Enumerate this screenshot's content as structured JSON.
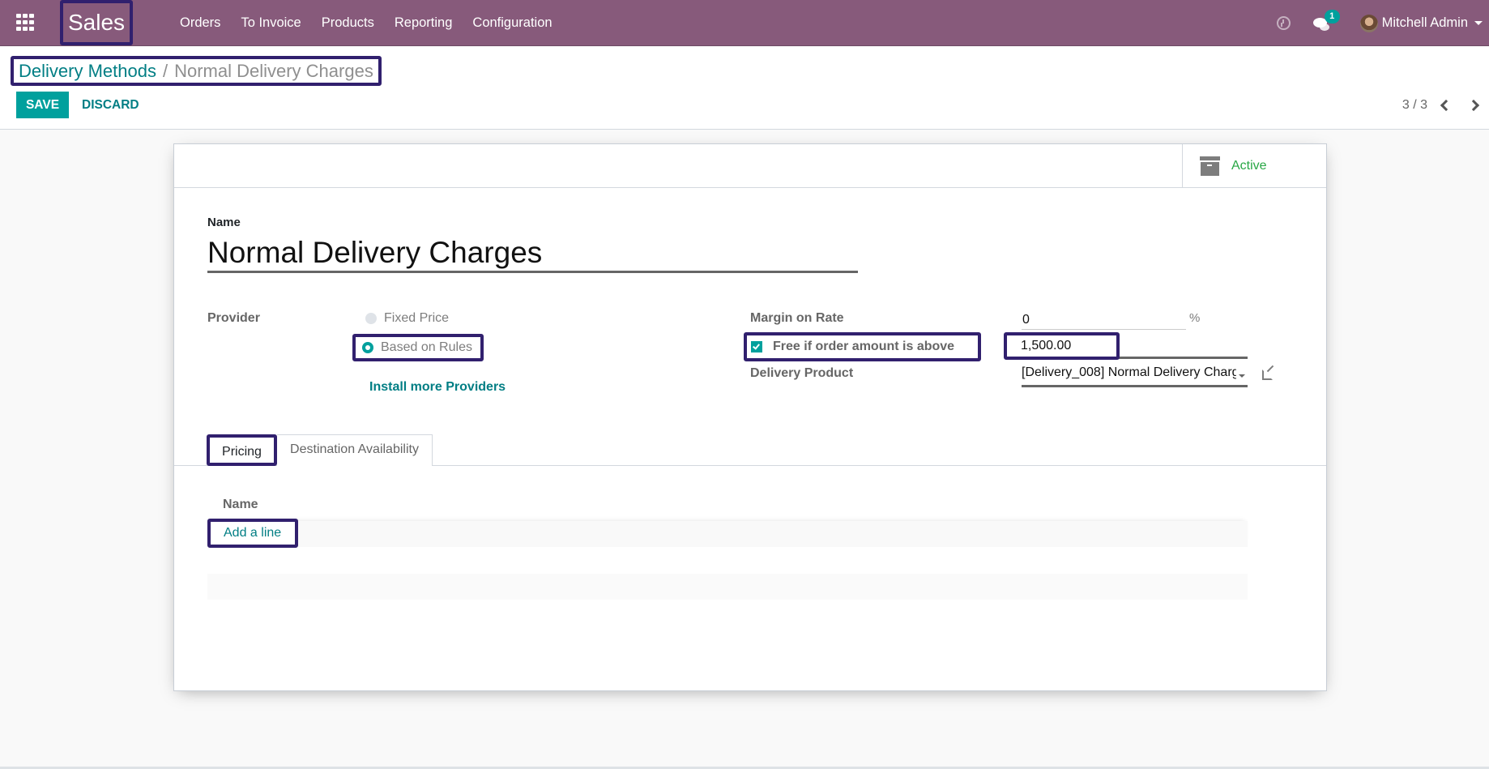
{
  "navbar": {
    "app_name": "Sales",
    "menu": [
      "Orders",
      "To Invoice",
      "Products",
      "Reporting",
      "Configuration"
    ],
    "messages_badge": "1",
    "user_name": "Mitchell Admin",
    "icons": {
      "apps": "apps-grid-icon",
      "activity": "clock-icon",
      "messages": "chat-icon",
      "user_menu": "caret-down-icon"
    }
  },
  "breadcrumb": {
    "parent": "Delivery Methods",
    "separator": "/",
    "current": "Normal Delivery Charges"
  },
  "buttons": {
    "save": "SAVE",
    "discard": "DISCARD"
  },
  "pager": {
    "value": "3 / 3"
  },
  "statusbar": {
    "active_label": "Active"
  },
  "form": {
    "name_label": "Name",
    "name_value": "Normal Delivery Charges",
    "provider_label": "Provider",
    "provider_options": [
      {
        "label": "Fixed Price",
        "checked": false
      },
      {
        "label": "Based on Rules",
        "checked": true
      }
    ],
    "install_more": "Install more Providers",
    "margin_label": "Margin on Rate",
    "margin_value": "0",
    "margin_unit": "%",
    "free_label": "Free if order amount is above",
    "free_checked": true,
    "free_amount": "1,500.00",
    "delivery_product_label": "Delivery Product",
    "delivery_product_value": "[Delivery_008] Normal Delivery Charg"
  },
  "tabs": [
    {
      "label": "Pricing",
      "active": true
    },
    {
      "label": "Destination Availability",
      "active": false
    }
  ],
  "pricing_table": {
    "columns": [
      "Name"
    ],
    "add_line": "Add a line"
  },
  "colors": {
    "brand": "#875a7b",
    "primary": "#00a09d",
    "link": "#017e84",
    "active_status": "#28a745",
    "highlight_box": "#31206e"
  }
}
